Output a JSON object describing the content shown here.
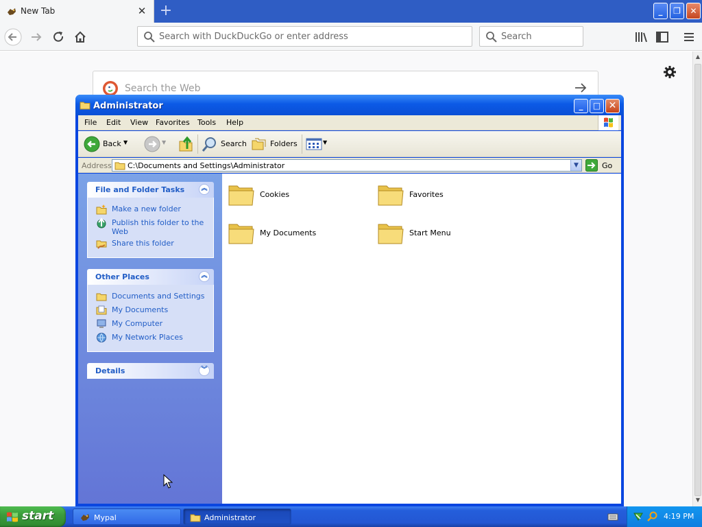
{
  "browser": {
    "tab_title": "New Tab",
    "url_placeholder": "Search with DuckDuckGo or enter address",
    "search_placeholder": "Search",
    "page": {
      "search_placeholder": "Search the Web"
    }
  },
  "explorer": {
    "title": "Administrator",
    "menu": [
      "File",
      "Edit",
      "View",
      "Favorites",
      "Tools",
      "Help"
    ],
    "toolbar": {
      "back_label": "Back",
      "search_label": "Search",
      "folders_label": "Folders"
    },
    "address": {
      "label": "Address",
      "value": "C:\\Documents and Settings\\Administrator",
      "go_label": "Go"
    },
    "panels": [
      {
        "title": "File and Folder Tasks",
        "items": [
          "Make a new folder",
          "Publish this folder to the Web",
          "Share this folder"
        ]
      },
      {
        "title": "Other Places",
        "items": [
          "Documents and Settings",
          "My Documents",
          "My Computer",
          "My Network Places"
        ]
      },
      {
        "title": "Details",
        "items": []
      }
    ],
    "folders": [
      "Cookies",
      "Favorites",
      "My Documents",
      "Start Menu"
    ]
  },
  "taskbar": {
    "start_label": "start",
    "buttons": [
      "Mypal",
      "Administrator"
    ],
    "clock": "4:19 PM"
  },
  "colors": {
    "xp_title_blue": "#0a4fd6",
    "task_link_blue": "#215dc6",
    "start_green": "#3c9c3c",
    "folder_yellow": "#f5d66b"
  }
}
